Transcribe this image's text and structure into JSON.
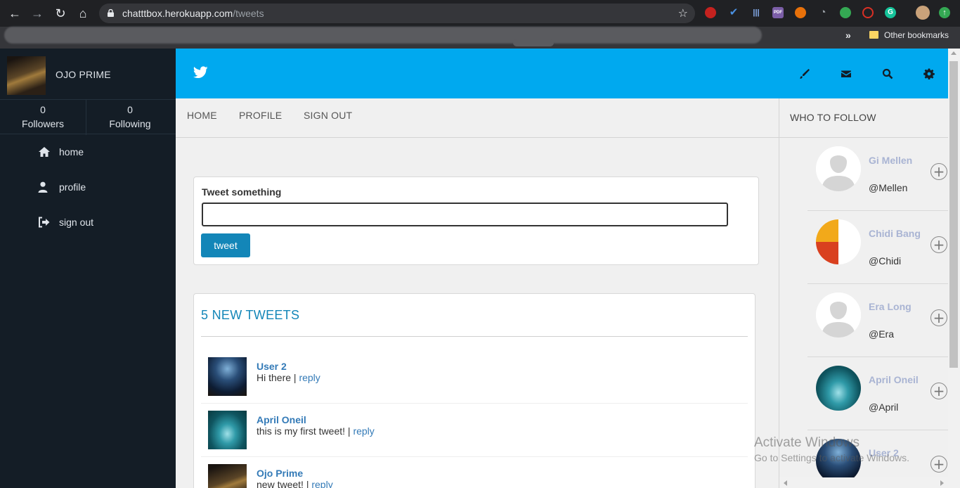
{
  "browser": {
    "url_host": "chatttbox.herokuapp.com",
    "url_path": "/tweets",
    "bookmarks_overflow": "»",
    "bookmarks_folder": "Other bookmarks"
  },
  "sidebar": {
    "username": "OJO PRIME",
    "stats": [
      {
        "count": "0",
        "label": "Followers"
      },
      {
        "count": "0",
        "label": "Following"
      }
    ],
    "links": [
      {
        "label": "home",
        "icon": "home-icon"
      },
      {
        "label": "profile",
        "icon": "user-icon"
      },
      {
        "label": "sign out",
        "icon": "sign-out-icon"
      }
    ]
  },
  "header": {
    "logo": "twitter-bird-icon",
    "icons": [
      "pencil-icon",
      "envelope-icon",
      "search-icon",
      "gear-icon"
    ]
  },
  "subnav": [
    "HOME",
    "PROFILE",
    "SIGN OUT"
  ],
  "composer": {
    "label": "Tweet something",
    "value": "",
    "button": "tweet"
  },
  "feed": {
    "title": "5 NEW TWEETS",
    "reply_label": "reply",
    "tweets": [
      {
        "user": "User 2",
        "text": "Hi there |"
      },
      {
        "user": "April Oneil",
        "text": "this is my first tweet! |"
      },
      {
        "user": "Ojo Prime",
        "text": "new tweet! |"
      }
    ]
  },
  "who_to_follow": {
    "title": "WHO TO FOLLOW",
    "users": [
      {
        "name": "Gi Mellen",
        "handle": "@Mellen"
      },
      {
        "name": "Chidi Bang",
        "handle": "@Chidi"
      },
      {
        "name": "Era Long",
        "handle": "@Era"
      },
      {
        "name": "April Oneil",
        "handle": "@April"
      },
      {
        "name": "User 2",
        "handle": ""
      }
    ]
  },
  "watermark": {
    "line1": "Activate Windows",
    "line2": "Go to Settings to activate Windows."
  },
  "colors": {
    "header_blue": "#00a9ef",
    "sidebar_dark": "#141d26",
    "accent_blue": "#1386b8",
    "link_blue": "#337ab7"
  }
}
